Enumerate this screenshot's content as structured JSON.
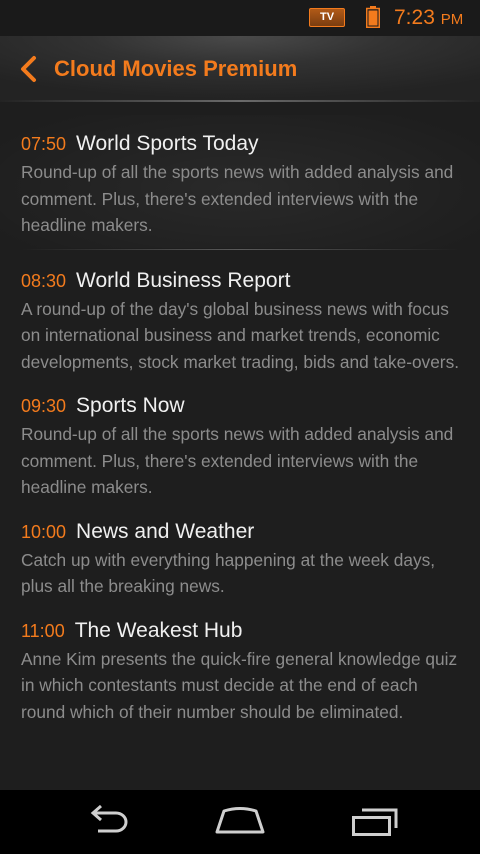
{
  "status_bar": {
    "tv_badge": "TV",
    "time": "7:23",
    "ampm": "PM",
    "icons": [
      "tv-icon",
      "battery-icon"
    ]
  },
  "action_bar": {
    "title": "Cloud Movies Premium",
    "back_icon": "back-chevron-icon"
  },
  "colors": {
    "accent": "#f37b1d",
    "background": "#1e1e1e",
    "title_text": "#f0f0f0",
    "description_text": "#8c8c8c"
  },
  "programs": [
    {
      "time": "07:50",
      "title": "World Sports Today",
      "description": "Round-up of all the sports news with added analysis and comment. Plus, there's extended interviews with the headline makers."
    },
    {
      "time": "08:30",
      "title": "World Business Report",
      "description": "A round-up of the day's global business news with focus on international business and market trends, economic developments, stock market trading, bids and take-overs."
    },
    {
      "time": "09:30",
      "title": "Sports Now",
      "description": "Round-up of all the sports news with added analysis and comment. Plus, there's extended interviews with the headline makers."
    },
    {
      "time": "10:00",
      "title": "News and Weather",
      "description": "Catch up with everything happening at the week days, plus all the breaking news."
    },
    {
      "time": "11:00",
      "title": "The Weakest Hub",
      "description": "Anne Kim presents the quick-fire general knowledge quiz in which contestants must decide at the end of each round which of their number should be eliminated."
    }
  ],
  "nav_bar": {
    "buttons": [
      "back-icon",
      "home-icon",
      "recent-apps-icon"
    ]
  }
}
